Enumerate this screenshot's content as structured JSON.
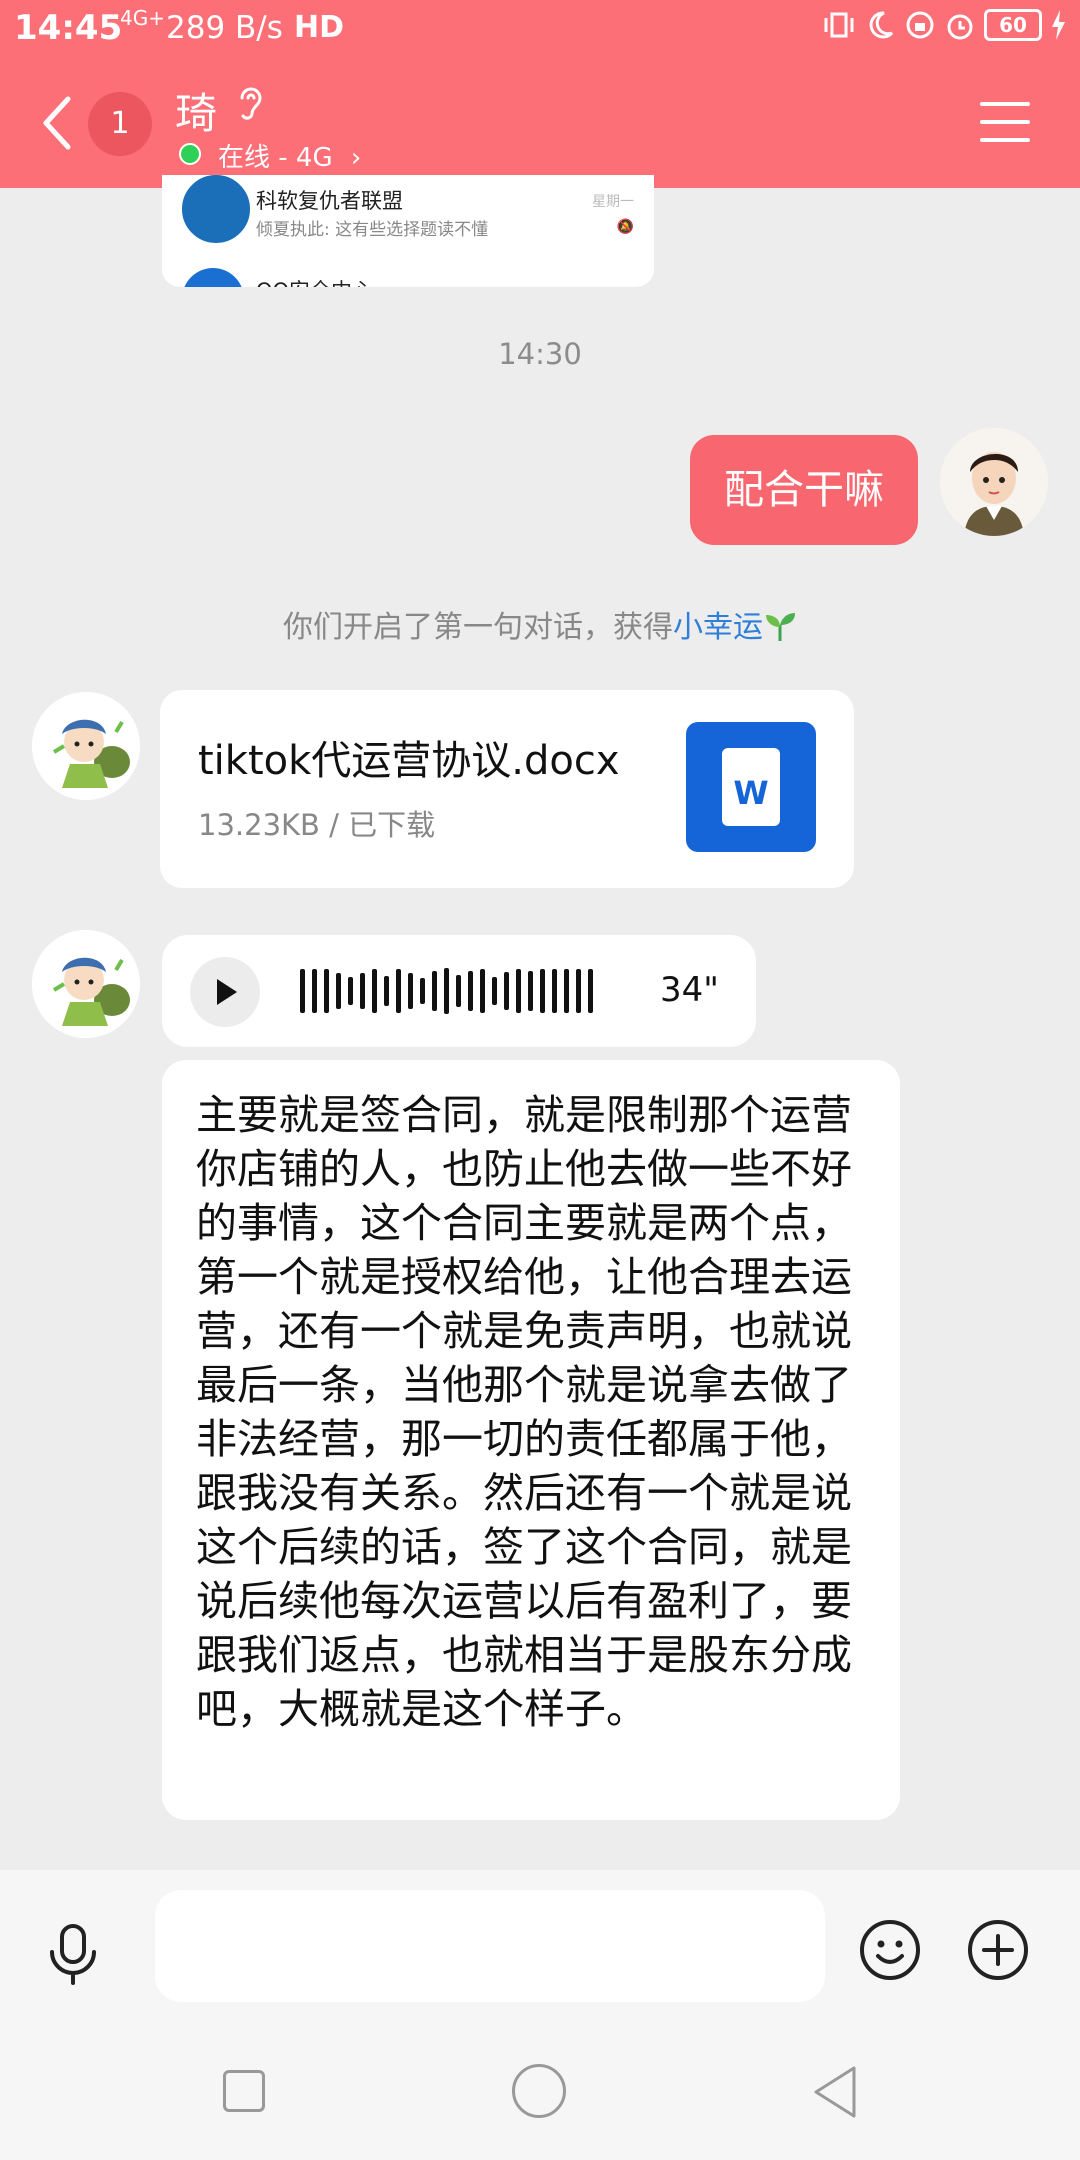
{
  "status_bar": {
    "time": "14:45",
    "network": "4G+",
    "speed": "289 B/s",
    "hd": "HD",
    "battery": "60"
  },
  "header": {
    "unread_count": "1",
    "contact_name": "琦",
    "status_text": "在线 - 4G"
  },
  "shared_card": {
    "title": "科软复仇者联盟",
    "description": "倾夏执此: 这有些选择题读不懂",
    "day": "星期一",
    "title2": "QQ安全中心"
  },
  "timestamp": "14:30",
  "outgoing_message": "配合干嘛",
  "system_message": {
    "text": "你们开启了第一句对话，获得",
    "link": "小幸运",
    "icon": "sprout-icon"
  },
  "file_message": {
    "file_name": "tiktok代运营协议.docx",
    "file_meta": "13.23KB / 已下载",
    "file_icon_letter": "W",
    "file_icon_color": "#1565d8"
  },
  "voice_message": {
    "duration": "34\""
  },
  "text_message": "主要就是签合同，就是限制那个运营你店铺的人，也防止他去做一些不好的事情，这个合同主要就是两个点，第一个就是授权给他，让他合理去运营，还有一个就是免责声明，也就说最后一条，当他那个就是说拿去做了非法经营，那一切的责任都属于他，跟我没有关系。然后还有一个就是说这个后续的话，签了这个合同，就是说后续他每次运营以后有盈利了，要跟我们返点，也就相当于是股东分成吧，大概就是这个样子。",
  "input": {
    "placeholder": ""
  },
  "colors": {
    "header": "#fd6f77",
    "outgoing_bubble": "#f8676f",
    "link": "#2f7fd8",
    "online": "#2ed058"
  }
}
